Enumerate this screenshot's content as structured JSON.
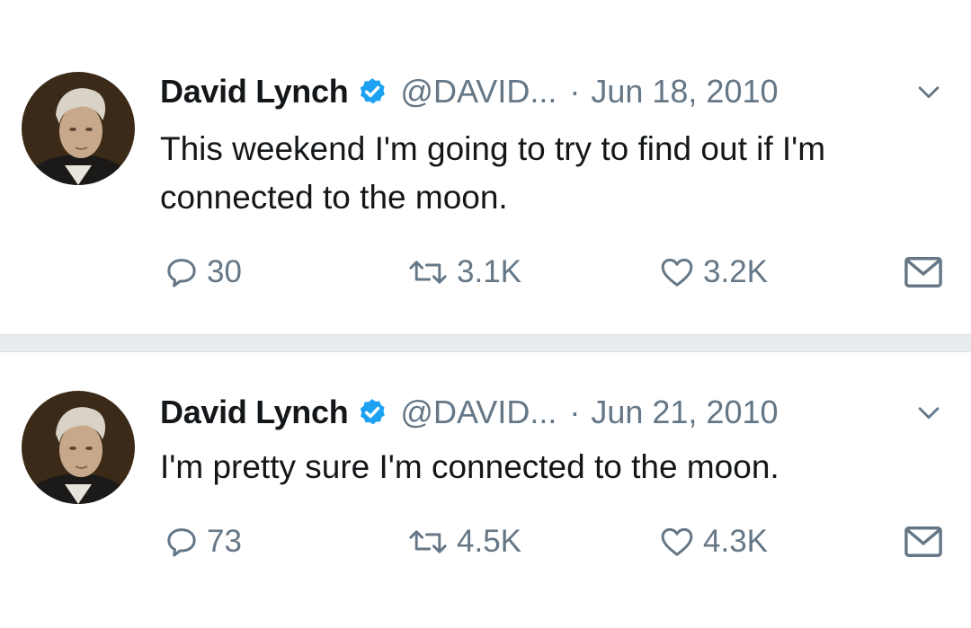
{
  "tweets": [
    {
      "author_name": "David Lynch",
      "handle": "@DAVID...",
      "separator": "·",
      "date": "Jun 18, 2010",
      "text": "This weekend I'm going to try to find out if I'm connected to the moon.",
      "replies": "30",
      "retweets": "3.1K",
      "likes": "3.2K",
      "icons": {
        "verified": "verified-badge-icon",
        "menu": "chevron-down-icon",
        "reply": "reply-bubble-icon",
        "retweet": "retweet-icon",
        "like": "heart-icon",
        "share": "envelope-icon"
      }
    },
    {
      "author_name": "David Lynch",
      "handle": "@DAVID...",
      "separator": "·",
      "date": "Jun 21, 2010",
      "text": "I'm pretty sure I'm connected to the moon.",
      "replies": "73",
      "retweets": "4.5K",
      "likes": "4.3K",
      "icons": {
        "verified": "verified-badge-icon",
        "menu": "chevron-down-icon",
        "reply": "reply-bubble-icon",
        "retweet": "retweet-icon",
        "like": "heart-icon",
        "share": "envelope-icon"
      }
    }
  ],
  "colors": {
    "text_primary": "#14171a",
    "text_secondary": "#657786",
    "verified_blue": "#1da1f2",
    "divider": "#e6ecf0",
    "background": "#ffffff"
  }
}
